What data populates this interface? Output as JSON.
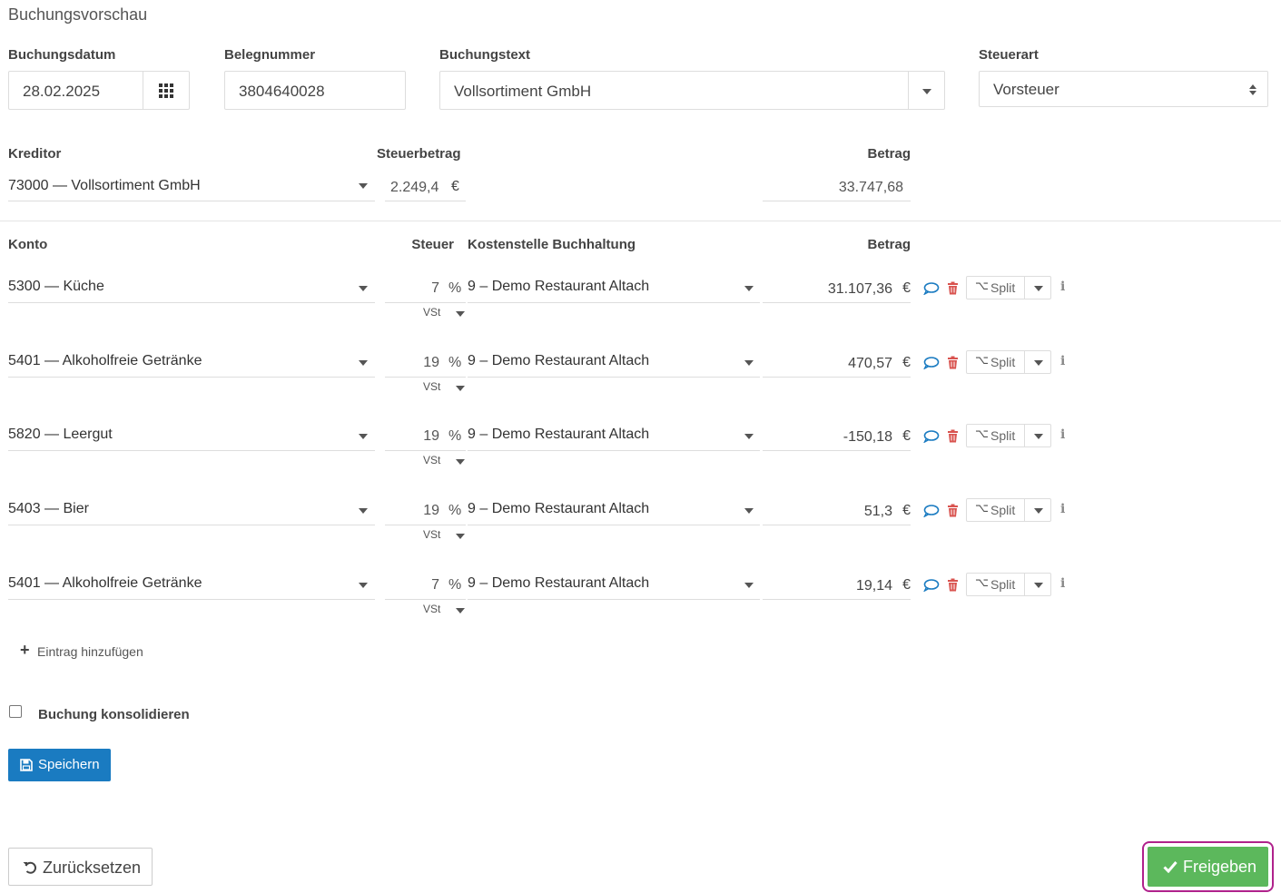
{
  "title": "Buchungsvorschau",
  "header": {
    "datum_label": "Buchungsdatum",
    "datum_value": "28.02.2025",
    "beleg_label": "Belegnummer",
    "beleg_value": "3804640028",
    "text_label": "Buchungstext",
    "text_value": "Vollsortiment GmbH",
    "steuerart_label": "Steuerart",
    "steuerart_value": "Vorsteuer"
  },
  "summary": {
    "kreditor_label": "Kreditor",
    "kreditor_value": "73000 — Vollsortiment GmbH",
    "steuerbetrag_label": "Steuerbetrag",
    "steuerbetrag_value": "2.249,4",
    "steuerbetrag_currency": "€",
    "betrag_label": "Betrag",
    "betrag_value": "33.747,68"
  },
  "table": {
    "col_konto": "Konto",
    "col_steuer": "Steuer",
    "col_kostenstelle": "Kostenstelle Buchhaltung",
    "col_betrag": "Betrag",
    "rows": [
      {
        "konto": "5300 — Küche",
        "steuer": "7",
        "pct": "%",
        "vst": "VSt",
        "kostenstelle": "9 – Demo Restaurant Altach",
        "betrag": "31.107,36",
        "currency": "€",
        "split": "Split"
      },
      {
        "konto": "5401 — Alkoholfreie Getränke",
        "steuer": "19",
        "pct": "%",
        "vst": "VSt",
        "kostenstelle": "9 – Demo Restaurant Altach",
        "betrag": "470,57",
        "currency": "€",
        "split": "Split"
      },
      {
        "konto": "5820 — Leergut",
        "steuer": "19",
        "pct": "%",
        "vst": "VSt",
        "kostenstelle": "9 – Demo Restaurant Altach",
        "betrag": "-150,18",
        "currency": "€",
        "split": "Split"
      },
      {
        "konto": "5403 — Bier",
        "steuer": "19",
        "pct": "%",
        "vst": "VSt",
        "kostenstelle": "9 – Demo Restaurant Altach",
        "betrag": "51,3",
        "currency": "€",
        "split": "Split"
      },
      {
        "konto": "5401 — Alkoholfreie Getränke",
        "steuer": "7",
        "pct": "%",
        "vst": "VSt",
        "kostenstelle": "9 – Demo Restaurant Altach",
        "betrag": "19,14",
        "currency": "€",
        "split": "Split"
      }
    ]
  },
  "add_entry_label": "Eintrag hinzufügen",
  "consolidate_label": "Buchung konsolidieren",
  "save_label": "Speichern",
  "reset_label": "Zurücksetzen",
  "approve_label": "Freigeben",
  "colors": {
    "primary": "#1a7bc1",
    "success": "#5cb85c",
    "danger": "#d9534f",
    "highlight": "#b0228c"
  }
}
